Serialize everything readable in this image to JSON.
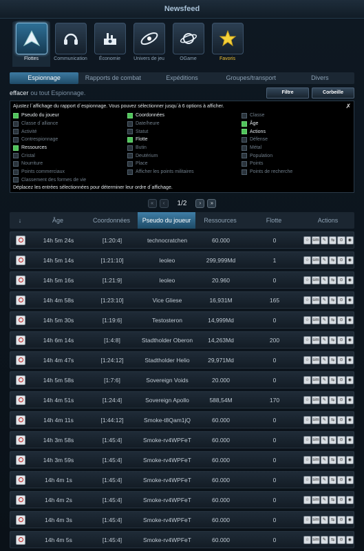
{
  "window": {
    "title": "Newsfeed"
  },
  "categories": [
    {
      "label": "Flottes",
      "icon": "fleet-icon",
      "active": true
    },
    {
      "label": "Communication",
      "icon": "headset-icon"
    },
    {
      "label": "Économie",
      "icon": "factory-icon"
    },
    {
      "label": "Univers de jeu",
      "icon": "galaxy-icon"
    },
    {
      "label": "OGame",
      "icon": "planet-icon"
    },
    {
      "label": "Favoris",
      "icon": "star-icon",
      "fav": true
    }
  ],
  "tabs": [
    "Espionnage",
    "Rapports de combat",
    "Expéditions",
    "Groupes/transport",
    "Divers"
  ],
  "actions": {
    "delete": "effacer",
    "rest": "ou tout Espionnage.",
    "filter": "Filtre",
    "trash": "Corbeille"
  },
  "panel": {
    "close": "✗",
    "intro": "Ajustez l´affichage du rapport d´espionnage. Vous pouvez sélectionner jusqu´à 6 options à afficher.",
    "footer": "Déplacez les entrées sélectionnées pour déterminer leur ordre d´affichage.",
    "col1": [
      {
        "label": "Pseudo du joueur",
        "on": true
      },
      {
        "label": "Classe d´alliance",
        "on": false
      },
      {
        "label": "Activité",
        "on": false
      },
      {
        "label": "Contrespionnage",
        "on": false
      },
      {
        "label": "Ressources",
        "on": true
      },
      {
        "label": "Cristal",
        "on": false
      },
      {
        "label": "Nourriture",
        "on": false
      },
      {
        "label": "Points commerciaux",
        "on": false
      },
      {
        "label": "Classement des formes de vie",
        "on": false
      }
    ],
    "col2": [
      {
        "label": "Coordonnées",
        "on": true
      },
      {
        "label": "Date/heure",
        "on": false
      },
      {
        "label": "Statut",
        "on": false
      },
      {
        "label": "Flotte",
        "on": true
      },
      {
        "label": "Butin",
        "on": false
      },
      {
        "label": "Deutérium",
        "on": false
      },
      {
        "label": "Place",
        "on": false
      },
      {
        "label": "Afficher les points militaires",
        "on": false
      }
    ],
    "col3": [
      {
        "label": "Classe",
        "on": false
      },
      {
        "label": "Âge",
        "on": true
      },
      {
        "label": "Actions",
        "on": true
      },
      {
        "label": "Défense",
        "on": false
      },
      {
        "label": "Métal",
        "on": false
      },
      {
        "label": "Population",
        "on": false
      },
      {
        "label": "Points",
        "on": false
      },
      {
        "label": "Points de recherche",
        "on": false
      }
    ]
  },
  "pager": {
    "first": "«",
    "prev": "‹",
    "text": "1/2",
    "next": "›",
    "last": "»"
  },
  "table": {
    "headers": [
      "↓",
      "Âge",
      "Coordonnées",
      "Pseudo du joueur",
      "Ressources",
      "Flotte",
      "Actions"
    ],
    "rows": [
      {
        "age": "14h 5m 24s",
        "coords": "[1:20:4]",
        "player": "technocratchen",
        "res": "60.000",
        "fleet": "0"
      },
      {
        "age": "14h 5m 14s",
        "coords": "[1:21:10]",
        "player": "leoleo",
        "res": "299,999Md",
        "fleet": "1"
      },
      {
        "age": "14h 5m 16s",
        "coords": "[1:21:9]",
        "player": "leoleo",
        "res": "20.960",
        "fleet": "0"
      },
      {
        "age": "14h 4m 58s",
        "coords": "[1:23:10]",
        "player": "Vice Gliese",
        "res": "16,931M",
        "fleet": "165"
      },
      {
        "age": "14h 5m 30s",
        "coords": "[1:19:6]",
        "player": "Testosteron",
        "res": "14,999Md",
        "fleet": "0"
      },
      {
        "age": "14h 6m 14s",
        "coords": "[1:4:8]",
        "player": "Stadtholder Oberon",
        "res": "14,263Md",
        "fleet": "200"
      },
      {
        "age": "14h 4m 47s",
        "coords": "[1:24:12]",
        "player": "Stadtholder Helio",
        "res": "29,971Md",
        "fleet": "0"
      },
      {
        "age": "14h 5m 58s",
        "coords": "[1:7:6]",
        "player": "Sovereign Voids",
        "res": "20.000",
        "fleet": "0"
      },
      {
        "age": "14h 4m 51s",
        "coords": "[1:24:4]",
        "player": "Sovereign Apollo",
        "res": "588,54M",
        "fleet": "170"
      },
      {
        "age": "14h 4m 11s",
        "coords": "[1:44:12]",
        "player": "Smoke-t8Qam1jQ",
        "res": "60.000",
        "fleet": "0"
      },
      {
        "age": "14h 3m 58s",
        "coords": "[1:45:4]",
        "player": "Smoke-rv4WPFeT",
        "res": "60.000",
        "fleet": "0"
      },
      {
        "age": "14h 3m 59s",
        "coords": "[1:45:4]",
        "player": "Smoke-rv4WPFeT",
        "res": "60.000",
        "fleet": "0"
      },
      {
        "age": "14h 4m 1s",
        "coords": "[1:45:4]",
        "player": "Smoke-rv4WPFeT",
        "res": "60.000",
        "fleet": "0"
      },
      {
        "age": "14h 4m 2s",
        "coords": "[1:45:4]",
        "player": "Smoke-rv4WPFeT",
        "res": "60.000",
        "fleet": "0"
      },
      {
        "age": "14h 4m 3s",
        "coords": "[1:45:4]",
        "player": "Smoke-rv4WPFeT",
        "res": "60.000",
        "fleet": "0"
      },
      {
        "age": "14h 4m 5s",
        "coords": "[1:45:4]",
        "player": "Smoke-rv4WPFeT",
        "res": "60.000",
        "fleet": "0"
      }
    ],
    "action_icons": [
      "☆",
      "sim",
      "✎",
      "⇆",
      "⊙",
      "◉"
    ]
  }
}
